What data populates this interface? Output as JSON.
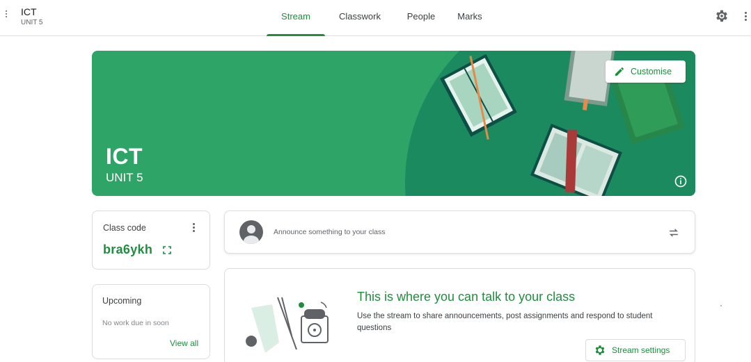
{
  "header": {
    "class_name": "ICT",
    "class_section": "UNIT 5",
    "tabs": [
      {
        "label": "Stream",
        "active": true
      },
      {
        "label": "Classwork",
        "active": false
      },
      {
        "label": "People",
        "active": false
      },
      {
        "label": "Marks",
        "active": false
      }
    ],
    "icons": [
      "menu-dots-icon",
      "gear-icon",
      "kebab-menu-icon"
    ]
  },
  "banner": {
    "title": "ICT",
    "subtitle": "UNIT 5",
    "customise_label": "Customise",
    "color": "#2ea567",
    "icons": [
      "pencil-icon",
      "info-icon"
    ]
  },
  "class_code": {
    "label": "Class code",
    "code": "bra6ykh"
  },
  "upcoming": {
    "title": "Upcoming",
    "empty_text": "No work due in soon",
    "view_all_label": "View all"
  },
  "announce": {
    "placeholder": "Announce something to your class"
  },
  "talk": {
    "title": "This is where you can talk to your class",
    "description": "Use the stream to share announcements, post assignments and respond to student questions",
    "settings_label": "Stream settings"
  },
  "colors": {
    "accent": "#1e8e3e",
    "banner_green": "#2ea567",
    "banner_dark": "#1b7f57"
  }
}
